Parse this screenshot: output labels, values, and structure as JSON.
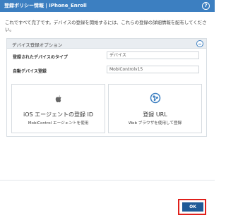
{
  "window": {
    "title": "登録ポリシー情報 | iPhone_Enroll",
    "help_glyph": "?"
  },
  "intro_text": "これですべて完了です。デバイスの登録を開始するには、これらの登録の詳細情報を配布してください。",
  "panel": {
    "title": "デバイス登録オプション",
    "fields": [
      {
        "label": "登録されたデバイスのタイプ",
        "value": "デバイス"
      },
      {
        "label": "自動デバイス登録",
        "value": "MobiControlv15"
      }
    ],
    "options": [
      {
        "title": "iOS エージェントの登録 ID",
        "subtitle": "MobiControl エージェントを使用",
        "icon": "apple-icon"
      },
      {
        "title": "登録 URL",
        "subtitle": "Web ブラウザを使用して登録",
        "icon": "globe-network-icon"
      }
    ]
  },
  "footer": {
    "ok_label": "OK"
  },
  "colors": {
    "titlebar": "#3c7fc1",
    "ok_button": "#1f5a97",
    "highlight": "#e0201b"
  }
}
